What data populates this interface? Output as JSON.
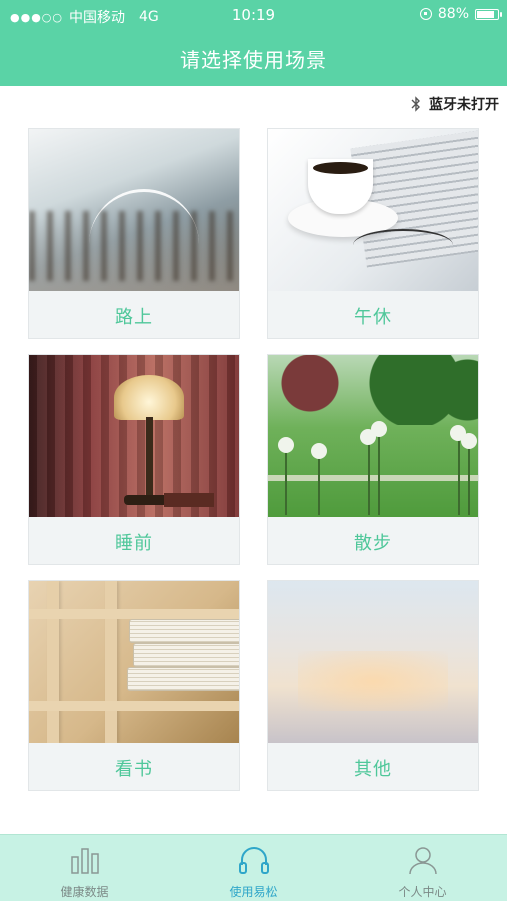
{
  "status_bar": {
    "signal": "●●●○○",
    "carrier": "中国移动",
    "network": "4G",
    "time": "10:19",
    "battery": "88%",
    "battery_level": 0.88
  },
  "header": {
    "title": "请选择使用场景"
  },
  "bluetooth": {
    "status_text": "蓝牙未打开"
  },
  "scenes": [
    {
      "label": "路上",
      "image": "commuter-station-photo"
    },
    {
      "label": "午休",
      "image": "coffee-newspaper-photo"
    },
    {
      "label": "睡前",
      "image": "bedside-lamp-photo"
    },
    {
      "label": "散步",
      "image": "park-walk-photo"
    },
    {
      "label": "看书",
      "image": "bookshelf-photo"
    },
    {
      "label": "其他",
      "image": "blurred-sky-photo"
    }
  ],
  "tabbar": {
    "tabs": [
      {
        "label": "健康数据",
        "icon": "bar-chart-icon",
        "active": false
      },
      {
        "label": "使用易松",
        "icon": "headphones-icon",
        "active": true
      },
      {
        "label": "个人中心",
        "icon": "person-icon",
        "active": false
      }
    ]
  },
  "colors": {
    "header_bg": "#5ad3a6",
    "accent_text": "#4fc79a",
    "tabbar_bg": "#c7f2e4",
    "active_tab": "#2fa6c9",
    "inactive_tab": "#7c8a87"
  }
}
